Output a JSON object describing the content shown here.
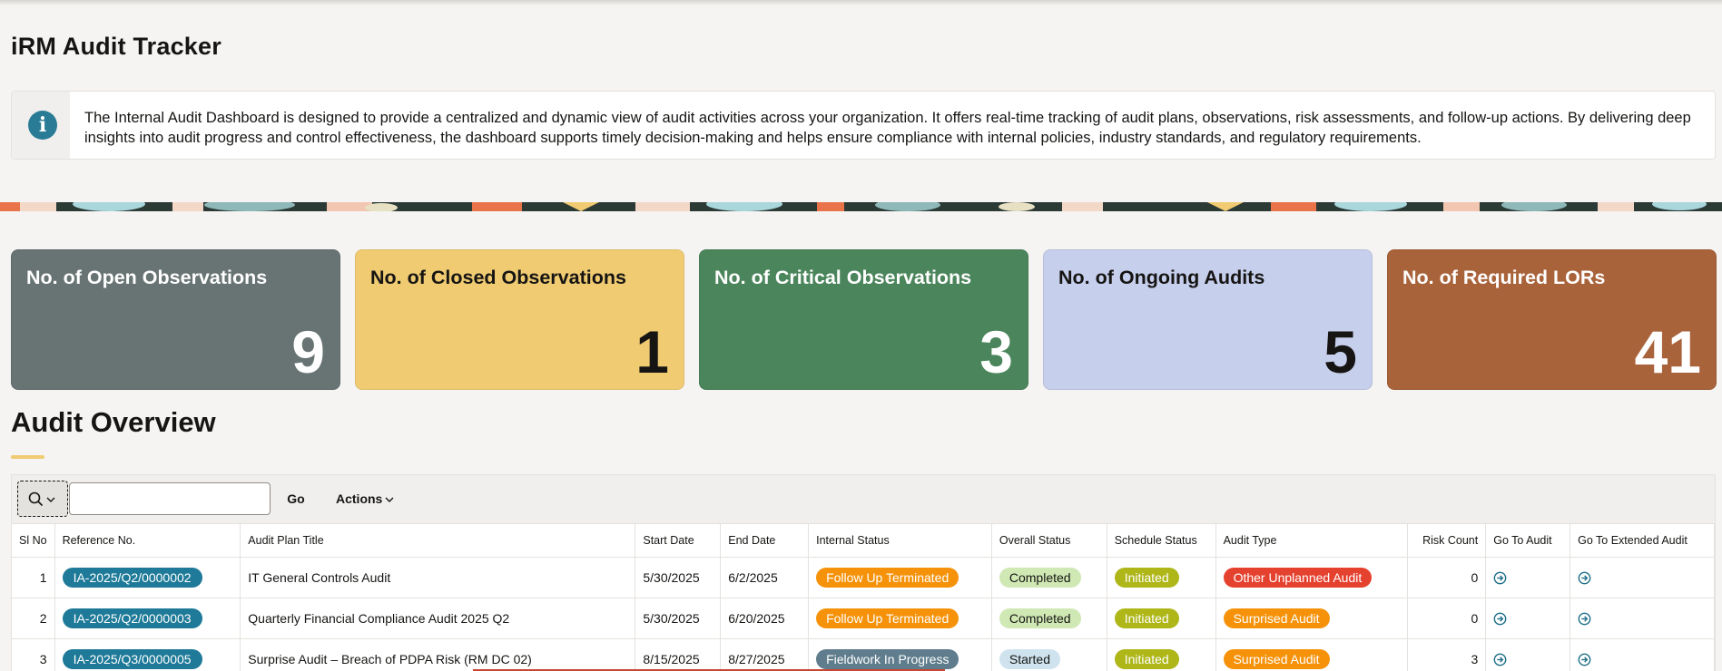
{
  "page": {
    "title": "iRM Audit Tracker"
  },
  "info": {
    "icon": "info-icon",
    "text": "The Internal Audit Dashboard is designed to provide a centralized and dynamic view of audit activities across your organization. It offers real-time tracking of audit plans, observations, risk assessments, and follow-up actions. By delivering deep insights into audit progress and control effectiveness, the dashboard supports timely decision-making and helps ensure compliance with internal policies, industry standards, and regulatory requirements."
  },
  "cards": [
    {
      "title": "No. of Open Observations",
      "value": "9",
      "color": "#687473"
    },
    {
      "title": "No. of Closed Observations",
      "value": "1",
      "color": "#f0cb72"
    },
    {
      "title": "No. of Critical Observations",
      "value": "3",
      "color": "#4a855b"
    },
    {
      "title": "No. of Ongoing Audits",
      "value": "5",
      "color": "#c6cfec"
    },
    {
      "title": "No. of Required LORs",
      "value": "41",
      "color": "#a9633b"
    }
  ],
  "overview": {
    "title": "Audit Overview",
    "search": {
      "icon": "search-icon",
      "value": "",
      "placeholder": ""
    },
    "go_label": "Go",
    "actions_label": "Actions",
    "columns": [
      "Sl No",
      "Reference No.",
      "Audit Plan Title",
      "Start Date",
      "End Date",
      "Internal Status",
      "Overall Status",
      "Schedule Status",
      "Audit Type",
      "Risk Count",
      "Go To Audit",
      "Go To Extended Audit"
    ],
    "rows": [
      {
        "sl": "1",
        "ref": "IA-2025/Q2/0000002",
        "title": "IT General Controls Audit",
        "start": "5/30/2025",
        "end": "6/2/2025",
        "internal": "Follow Up Terminated",
        "overall": "Completed",
        "schedule": "Initiated",
        "type": "Other Unplanned Audit",
        "risk": "0"
      },
      {
        "sl": "2",
        "ref": "IA-2025/Q2/0000003",
        "title": "Quarterly Financial Compliance Audit 2025 Q2",
        "start": "5/30/2025",
        "end": "6/20/2025",
        "internal": "Follow Up Terminated",
        "overall": "Completed",
        "schedule": "Initiated",
        "type": "Surprised Audit",
        "risk": "0"
      },
      {
        "sl": "3",
        "ref": "IA-2025/Q3/0000005",
        "title": "Surprise Audit – Breach of PDPA Risk (RM DC 02)",
        "start": "8/15/2025",
        "end": "8/27/2025",
        "internal": "Fieldwork In Progress",
        "overall": "Started",
        "schedule": "Initiated",
        "type": "Surprised Audit",
        "risk": "3"
      }
    ],
    "status_colors": {
      "Follow Up Terminated": "#f5920a",
      "Fieldwork In Progress": "#5f7d8c",
      "Completed": "#cfe8b4",
      "Started": "#cfe3ee",
      "Initiated": "#aeb618",
      "Other Unplanned Audit": "#e5412f",
      "Surprised Audit": "#f5920a"
    }
  }
}
